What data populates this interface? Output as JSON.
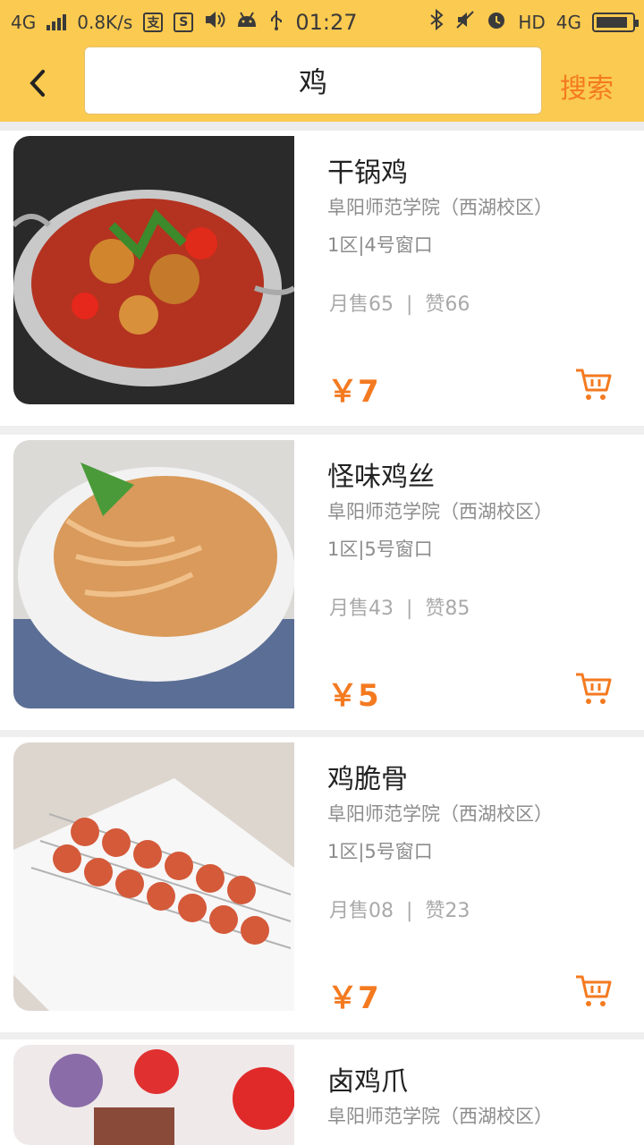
{
  "status_bar": {
    "network": "4G",
    "speed": "0.8K/s",
    "time": "01:27",
    "hd": "HD",
    "network_right": "4G"
  },
  "header": {
    "search_value": "鸡",
    "search_button": "搜索"
  },
  "colors": {
    "header_bg": "#fbca50",
    "accent": "#f47a20"
  },
  "items": [
    {
      "title": "干锅鸡",
      "school": "阜阳师范学院（西湖校区）",
      "window": "1区|4号窗口",
      "monthly": "月售65",
      "likes": "赞66",
      "price": "￥7"
    },
    {
      "title": "怪味鸡丝",
      "school": "阜阳师范学院（西湖校区）",
      "window": "1区|5号窗口",
      "monthly": "月售43",
      "likes": "赞85",
      "price": "￥5"
    },
    {
      "title": "鸡脆骨",
      "school": "阜阳师范学院（西湖校区）",
      "window": "1区|5号窗口",
      "monthly": "月售08",
      "likes": "赞23",
      "price": "￥7"
    },
    {
      "title": "卤鸡爪",
      "school": "阜阳师范学院（西湖校区）",
      "window": "",
      "monthly": "",
      "likes": "",
      "price": ""
    }
  ]
}
